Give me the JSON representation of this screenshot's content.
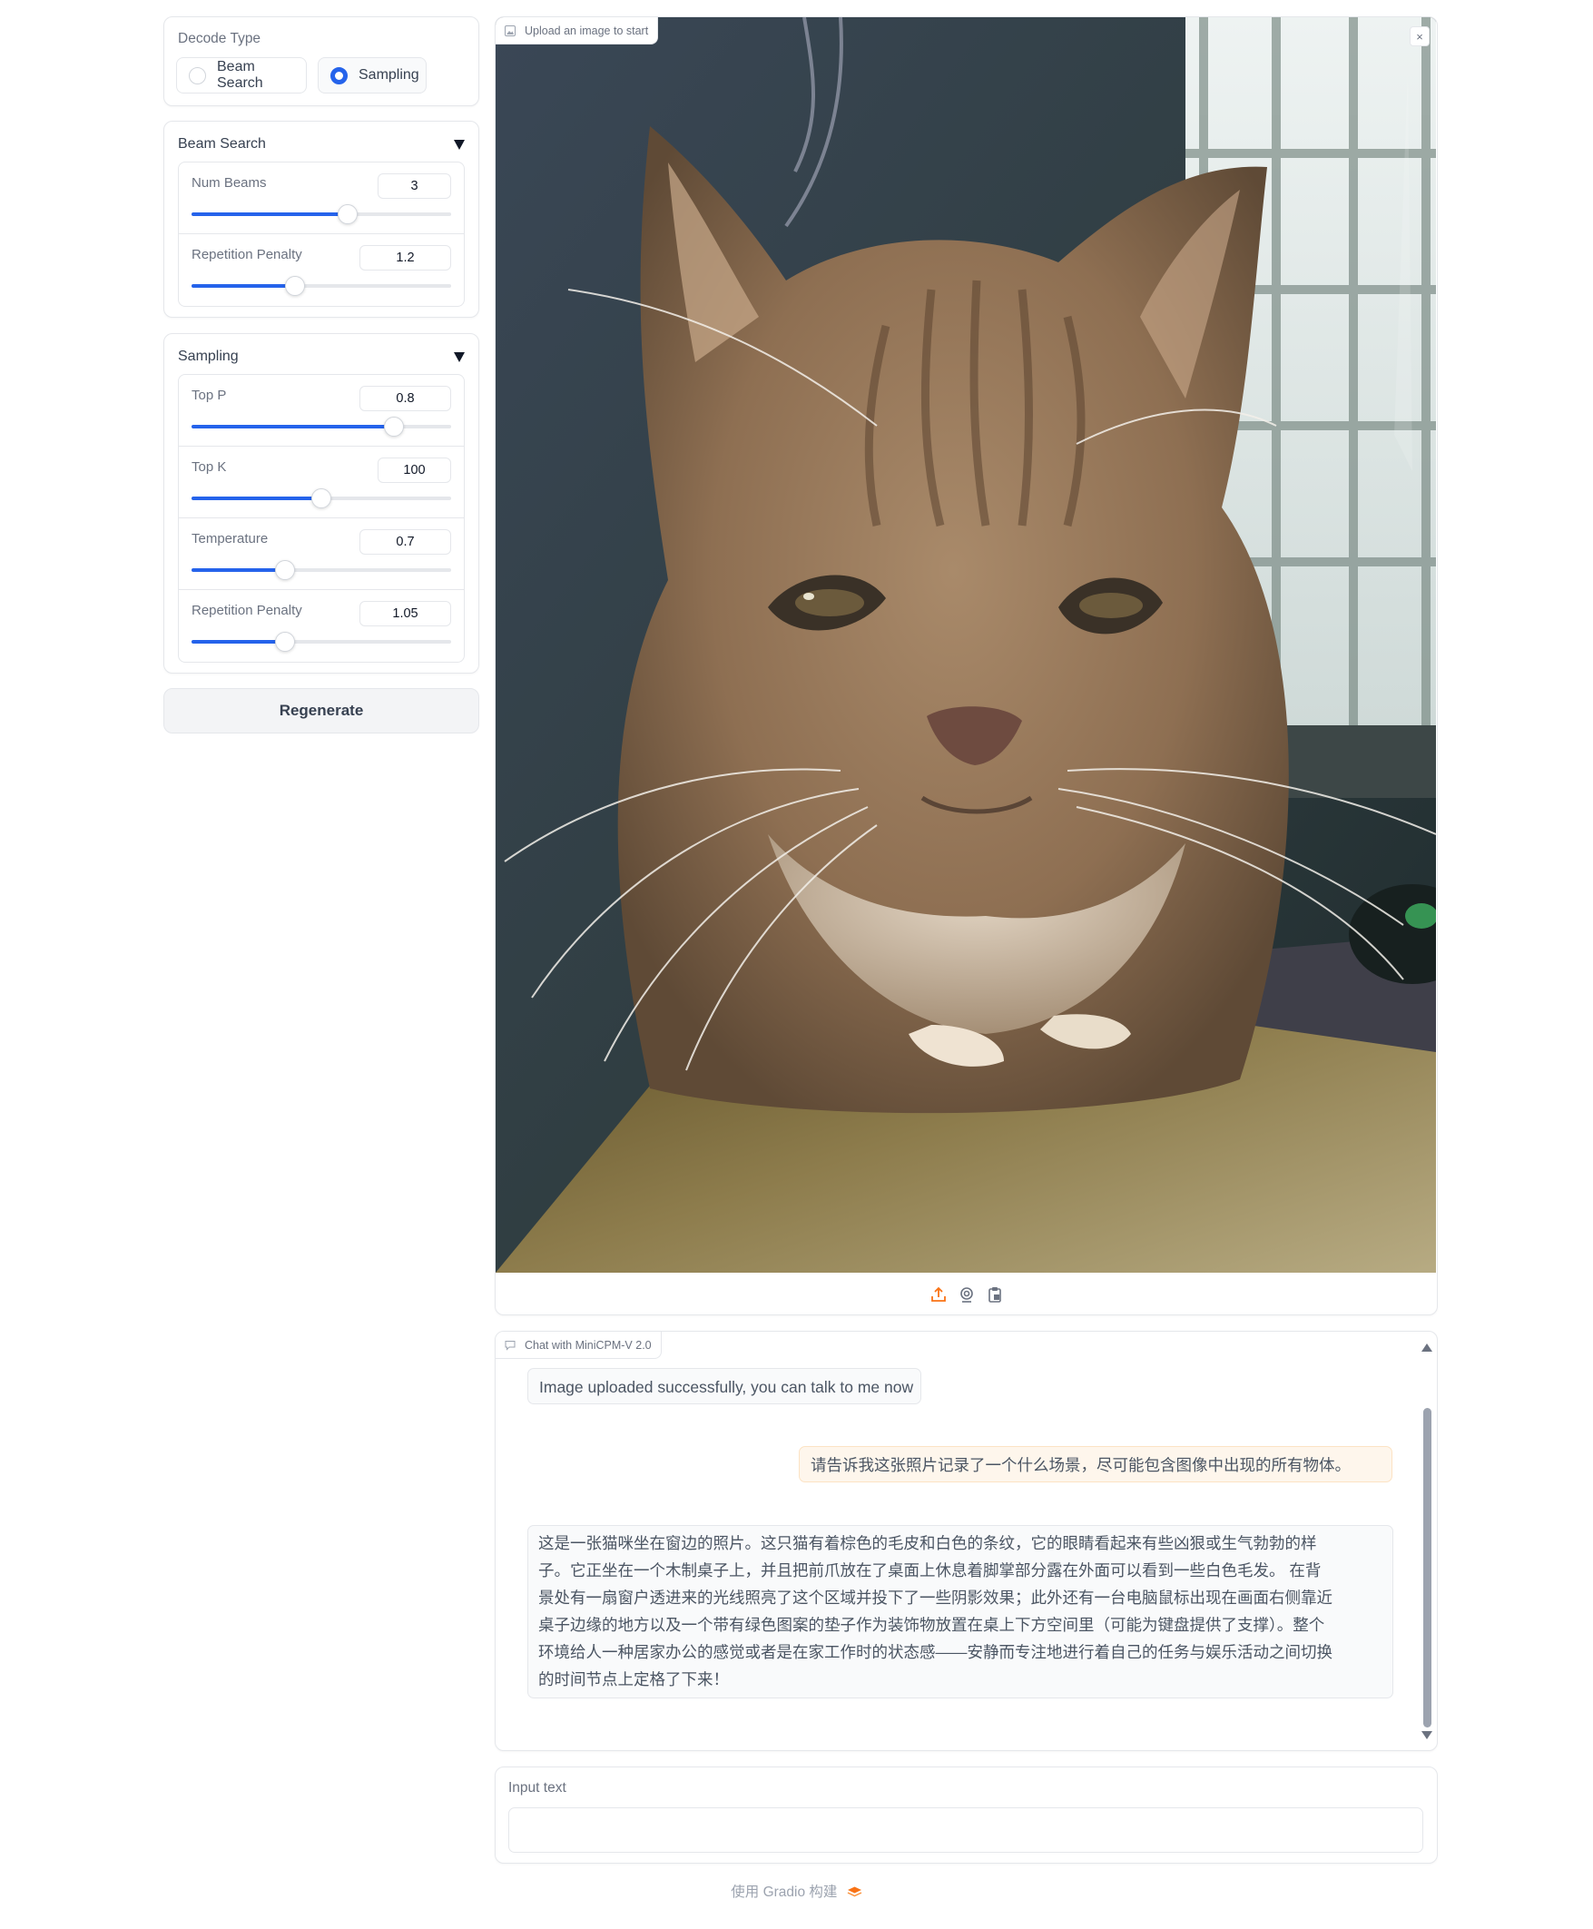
{
  "decode": {
    "label": "Decode Type",
    "options": [
      "Beam Search",
      "Sampling"
    ],
    "selected": "Sampling"
  },
  "beam_search": {
    "title": "Beam Search",
    "params": [
      {
        "label": "Num Beams",
        "value": "3",
        "level": 0.6
      },
      {
        "label": "Repetition Penalty",
        "value": "1.2",
        "level": 0.4
      }
    ]
  },
  "sampling": {
    "title": "Sampling",
    "params": [
      {
        "label": "Top P",
        "value": "0.8",
        "level": 0.78
      },
      {
        "label": "Top K",
        "value": "100",
        "level": 0.5
      },
      {
        "label": "Temperature",
        "value": "0.7",
        "level": 0.36
      },
      {
        "label": "Repetition Penalty",
        "value": "1.05",
        "level": 0.36
      }
    ]
  },
  "regenerate_label": "Regenerate",
  "image_panel": {
    "tag": "Upload an image to start",
    "close": "×"
  },
  "chat": {
    "tag": "Chat with MiniCPM-V 2.0",
    "messages": [
      {
        "role": "bot",
        "text": "Image uploaded successfully, you can talk to me now"
      },
      {
        "role": "user",
        "text": "请告诉我这张照片记录了一个什么场景，尽可能包含图像中出现的所有物体。"
      },
      {
        "role": "bot",
        "lines": [
          "这是一张猫咪坐在窗边的照片。这只猫有着棕色的毛皮和白色的条纹，它的眼睛看起来有些凶狠或生气勃勃的样",
          "子。它正坐在一个木制桌子上，并且把前爪放在了桌面上休息着脚掌部分露在外面可以看到一些白色毛发。 在背",
          "景处有一扇窗户透进来的光线照亮了这个区域并投下了一些阴影效果；此外还有一台电脑鼠标出现在画面右侧靠近",
          "桌子边缘的地方以及一个带有绿色图案的垫子作为装饰物放置在桌上下方空间里（可能为键盘提供了支撑）。整个",
          "环境给人一种居家办公的感觉或者是在家工作时的状态感——安静而专注地进行着自己的任务与娱乐活动之间切换",
          "的时间节点上定格了下来！"
        ]
      }
    ]
  },
  "input": {
    "label": "Input text",
    "value": ""
  },
  "footer": "使用 Gradio 构建",
  "colors": {
    "accent": "#2563eb",
    "user_bubble": "#fef6ec",
    "gradio_logo": "#f97316"
  },
  "icons": [
    "image-icon",
    "chat-icon",
    "upload-icon",
    "webcam-icon",
    "clipboard-icon",
    "close-icon",
    "gradio-logo-icon"
  ]
}
